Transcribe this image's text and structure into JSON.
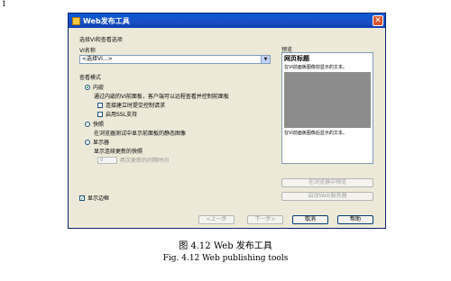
{
  "page_number": "1",
  "window": {
    "title": "Web发布工具",
    "close_glyph": "✕"
  },
  "vi_section": {
    "title": "选择VI和查看选项",
    "vi_name_label": "VI名称",
    "vi_name_value": "<选择VI...>",
    "dropdown_glyph": "▼"
  },
  "view_mode": {
    "title": "查看模式",
    "embedded_label": "内嵌",
    "embedded_desc": "通过内嵌的VI前面板，客户端可以远程查看并控制前面板",
    "request_control_label": "连接建立时提交控制请求",
    "enable_ssl_label": "启用SSL支持",
    "snapshot_label": "快照",
    "snapshot_desc": "在浏览器测试中显示前面板的静态图像",
    "monitor_label": "显示器",
    "monitor_desc": "显示连续更新的快照",
    "interval_value": "0",
    "interval_label": "两次更新的间隔时间",
    "selected": "embedded"
  },
  "show_border": {
    "label": "显示边框",
    "checked": true
  },
  "preview": {
    "label": "预览",
    "heading": "网页标题",
    "text_before": "在VI前面板图像前显示的文本。",
    "text_after": "在VI前面板图像后显示的文本。"
  },
  "buttons": {
    "preview_in_browser": "在浏览器中预览",
    "start_web_server": "启动Web服务器",
    "prev": "<上一步",
    "next": "下一步>",
    "cancel": "取消",
    "help": "帮助"
  },
  "caption": {
    "cn": "图 4.12  Web 发布工具",
    "en": "Fig. 4.12    Web publishing tools"
  }
}
